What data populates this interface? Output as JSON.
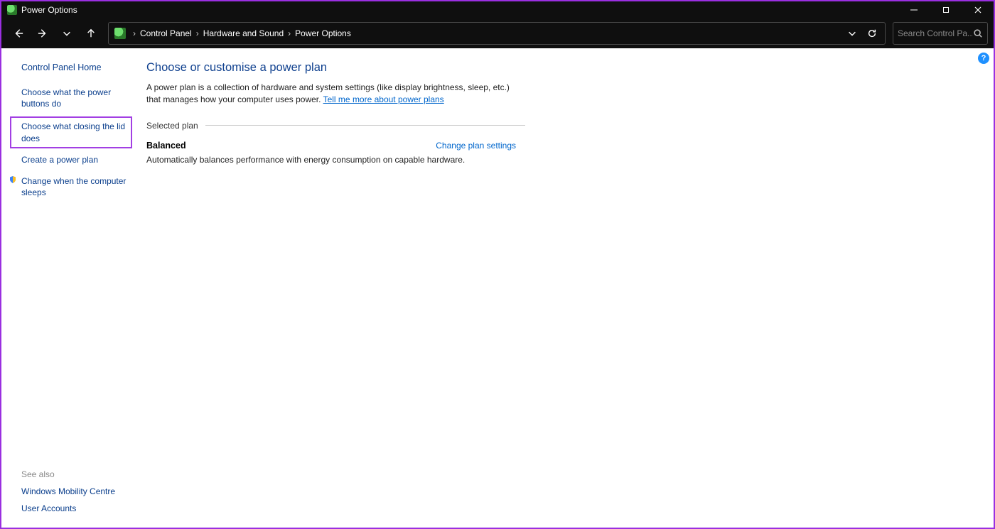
{
  "window": {
    "title": "Power Options"
  },
  "breadcrumb": {
    "items": [
      "Control Panel",
      "Hardware and Sound",
      "Power Options"
    ]
  },
  "search": {
    "placeholder": "Search Control Pa..."
  },
  "sidebar": {
    "home": "Control Panel Home",
    "links": [
      "Choose what the power buttons do",
      "Choose what closing the lid does",
      "Create a power plan",
      "Change when the computer sleeps"
    ],
    "see_also_label": "See also",
    "see_also": [
      "Windows Mobility Centre",
      "User Accounts"
    ]
  },
  "main": {
    "heading": "Choose or customise a power plan",
    "intro_a": "A power plan is a collection of hardware and system settings (like display brightness, sleep, etc.) that manages how your computer uses power. ",
    "intro_link": "Tell me more about power plans",
    "selected_label": "Selected plan",
    "plan_name": "Balanced",
    "change_link": "Change plan settings",
    "plan_desc": "Automatically balances performance with energy consumption on capable hardware."
  },
  "help_badge": "?"
}
